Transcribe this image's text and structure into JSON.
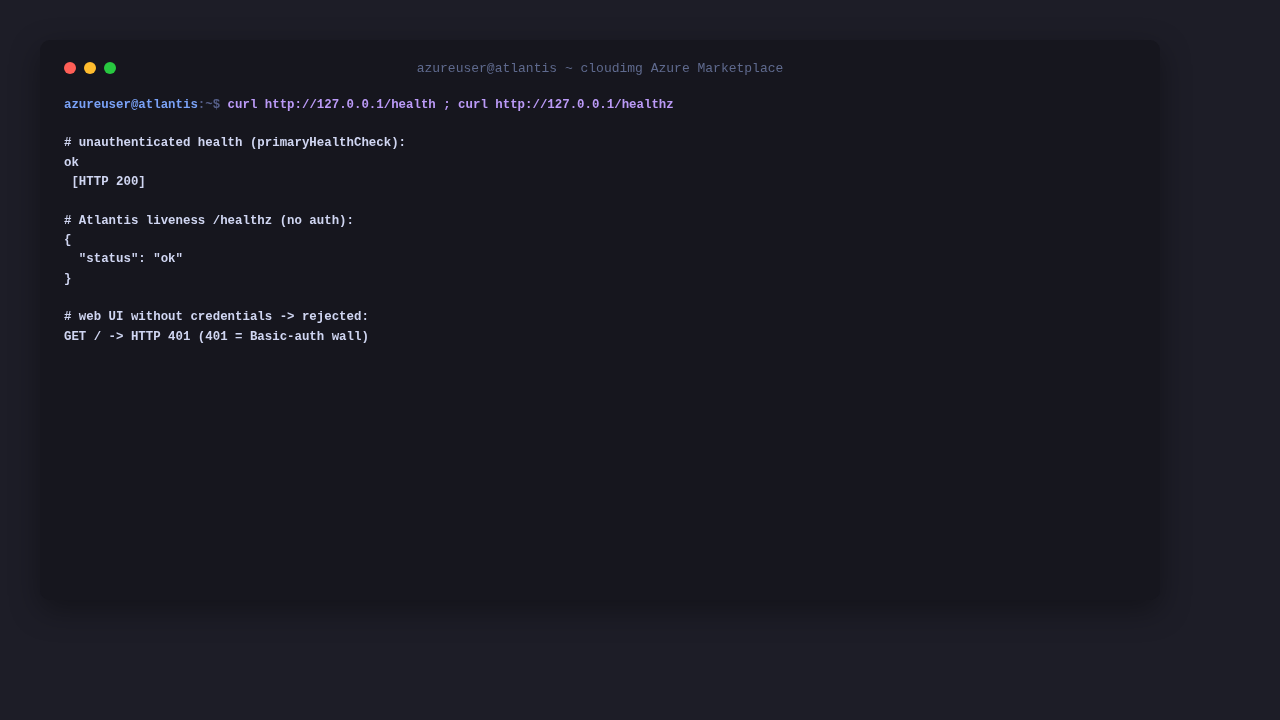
{
  "window": {
    "title": "azureuser@atlantis ~ cloudimg Azure Marketplace",
    "controls": [
      {
        "color": "#ff5f57"
      },
      {
        "color": "#febc2e"
      },
      {
        "color": "#28c840"
      }
    ]
  },
  "prompt": {
    "user_host": "azureuser@atlantis",
    "path": ":~$",
    "command": "curl http://127.0.0.1/health ; curl http://127.0.0.1/healthz"
  },
  "output_blocks": [
    {
      "lines": [
        "# unauthenticated health (primaryHealthCheck):",
        "ok",
        " [HTTP 200]"
      ]
    },
    {
      "lines": [
        "# Atlantis liveness /healthz (no auth):",
        "{",
        "  \"status\": \"ok\"",
        "}"
      ]
    },
    {
      "lines": [
        "# web UI without credentials -> rejected:",
        "GET / -> HTTP 401 (401 = Basic-auth wall)"
      ]
    }
  ]
}
